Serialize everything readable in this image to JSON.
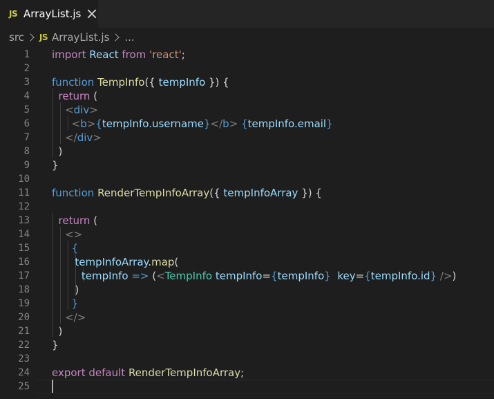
{
  "tab": {
    "icon": "JS",
    "filename": "ArrayList.js"
  },
  "breadcrumb": {
    "folder": "src",
    "icon": "JS",
    "file": "ArrayList.js",
    "more": "..."
  },
  "editor": {
    "line_numbers": [
      "1",
      "2",
      "3",
      "4",
      "5",
      "6",
      "7",
      "8",
      "9",
      "10",
      "11",
      "12",
      "13",
      "14",
      "15",
      "16",
      "17",
      "18",
      "19",
      "20",
      "21",
      "22",
      "23",
      "24",
      "25"
    ],
    "lines": [
      [
        {
          "t": "import",
          "c": "ctl"
        },
        {
          "t": " React ",
          "c": "var"
        },
        {
          "t": "from",
          "c": "ctl"
        },
        {
          "t": " ",
          "c": "plain"
        },
        {
          "t": "'react'",
          "c": "str"
        },
        {
          "t": ";",
          "c": "plain"
        }
      ],
      [],
      [
        {
          "t": "function",
          "c": "kw"
        },
        {
          "t": " ",
          "c": "plain"
        },
        {
          "t": "TempInfo",
          "c": "fn"
        },
        {
          "t": "({ ",
          "c": "plain"
        },
        {
          "t": "tempInfo",
          "c": "var"
        },
        {
          "t": " }) {",
          "c": "plain"
        }
      ],
      [
        {
          "t": "  ",
          "c": "plain"
        },
        {
          "t": "return",
          "c": "ctl"
        },
        {
          "t": " (",
          "c": "plain"
        }
      ],
      [
        {
          "t": "    ",
          "c": "plain"
        },
        {
          "t": "<",
          "c": "punct"
        },
        {
          "t": "div",
          "c": "tag"
        },
        {
          "t": ">",
          "c": "punct"
        }
      ],
      [
        {
          "t": "      ",
          "c": "plain"
        },
        {
          "t": "<",
          "c": "punct"
        },
        {
          "t": "b",
          "c": "tag"
        },
        {
          "t": ">",
          "c": "punct"
        },
        {
          "t": "{",
          "c": "kw"
        },
        {
          "t": "tempInfo.username",
          "c": "var"
        },
        {
          "t": "}",
          "c": "kw"
        },
        {
          "t": "</",
          "c": "punct"
        },
        {
          "t": "b",
          "c": "tag"
        },
        {
          "t": ">",
          "c": "punct"
        },
        {
          "t": " ",
          "c": "plain"
        },
        {
          "t": "{",
          "c": "kw"
        },
        {
          "t": "tempInfo.email",
          "c": "var"
        },
        {
          "t": "}",
          "c": "kw"
        }
      ],
      [
        {
          "t": "    ",
          "c": "plain"
        },
        {
          "t": "</",
          "c": "punct"
        },
        {
          "t": "div",
          "c": "tag"
        },
        {
          "t": ">",
          "c": "punct"
        }
      ],
      [
        {
          "t": "  )",
          "c": "plain"
        }
      ],
      [
        {
          "t": "}",
          "c": "plain"
        }
      ],
      [],
      [
        {
          "t": "function",
          "c": "kw"
        },
        {
          "t": " ",
          "c": "plain"
        },
        {
          "t": "RenderTempInfoArray",
          "c": "fn"
        },
        {
          "t": "({ ",
          "c": "plain"
        },
        {
          "t": "tempInfoArray",
          "c": "var"
        },
        {
          "t": " }) {",
          "c": "plain"
        }
      ],
      [],
      [
        {
          "t": "  ",
          "c": "plain"
        },
        {
          "t": "return",
          "c": "ctl"
        },
        {
          "t": " (",
          "c": "plain"
        }
      ],
      [
        {
          "t": "    ",
          "c": "plain"
        },
        {
          "t": "<>",
          "c": "punct"
        }
      ],
      [
        {
          "t": "      ",
          "c": "plain"
        },
        {
          "t": "{",
          "c": "kw"
        }
      ],
      [
        {
          "t": "       ",
          "c": "plain"
        },
        {
          "t": "tempInfoArray",
          "c": "var"
        },
        {
          "t": ".",
          "c": "plain"
        },
        {
          "t": "map",
          "c": "fn"
        },
        {
          "t": "(",
          "c": "plain"
        }
      ],
      [
        {
          "t": "         ",
          "c": "plain"
        },
        {
          "t": "tempInfo",
          "c": "var"
        },
        {
          "t": " ",
          "c": "plain"
        },
        {
          "t": "=>",
          "c": "kw"
        },
        {
          "t": " (",
          "c": "plain"
        },
        {
          "t": "<",
          "c": "punct"
        },
        {
          "t": "TempInfo",
          "c": "comp"
        },
        {
          "t": " ",
          "c": "plain"
        },
        {
          "t": "tempInfo",
          "c": "var"
        },
        {
          "t": "=",
          "c": "plain"
        },
        {
          "t": "{",
          "c": "kw"
        },
        {
          "t": "tempInfo",
          "c": "var"
        },
        {
          "t": "}",
          "c": "kw"
        },
        {
          "t": "  ",
          "c": "plain"
        },
        {
          "t": "key",
          "c": "var"
        },
        {
          "t": "=",
          "c": "plain"
        },
        {
          "t": "{",
          "c": "kw"
        },
        {
          "t": "tempInfo.id",
          "c": "var"
        },
        {
          "t": "}",
          "c": "kw"
        },
        {
          "t": " ",
          "c": "plain"
        },
        {
          "t": "/>",
          "c": "punct"
        },
        {
          "t": ")",
          "c": "plain"
        }
      ],
      [
        {
          "t": "       )",
          "c": "plain"
        }
      ],
      [
        {
          "t": "      ",
          "c": "plain"
        },
        {
          "t": "}",
          "c": "kw"
        }
      ],
      [
        {
          "t": "    ",
          "c": "plain"
        },
        {
          "t": "</>",
          "c": "punct"
        }
      ],
      [
        {
          "t": "  )",
          "c": "plain"
        }
      ],
      [
        {
          "t": "}",
          "c": "plain"
        }
      ],
      [],
      [
        {
          "t": "export",
          "c": "ctl"
        },
        {
          "t": " ",
          "c": "plain"
        },
        {
          "t": "default",
          "c": "ctl"
        },
        {
          "t": " ",
          "c": "plain"
        },
        {
          "t": "RenderTempInfoArray",
          "c": "fn"
        },
        {
          "t": ";",
          "c": "plain"
        }
      ],
      []
    ],
    "cursor_line": 25
  }
}
